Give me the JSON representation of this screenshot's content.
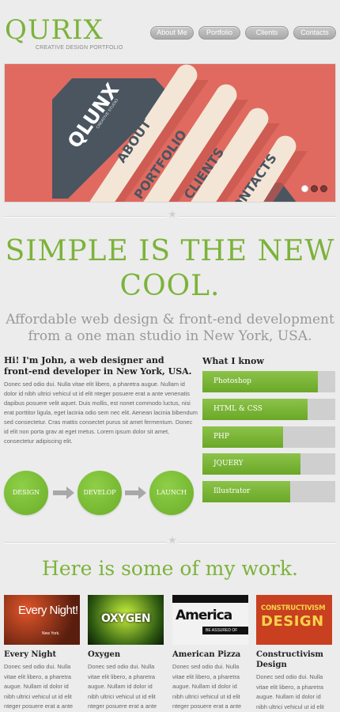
{
  "header": {
    "logo": "QURIX",
    "tagline": "CREATIVE DESIGN PORTFOLIO",
    "nav": [
      "About Me",
      "Portfolio",
      "Clients",
      "Contacts"
    ]
  },
  "slider": {
    "brand": "QLUNX",
    "brand_sub": "CREATIVE STUDIO",
    "items": [
      "ABOUT",
      "PORTFOLIO",
      "CLIENTS",
      "CONTACTS"
    ],
    "slide_count": 3,
    "active_slide": 1,
    "colors": {
      "background": "#e06a60",
      "panel": "#4a5560",
      "stripe": "#f4e6d6"
    }
  },
  "headline": "SIMPLE IS THE NEW COOL.",
  "subhead": "Affordable web design & front-end development from a one man studio in New York, USA.",
  "intro": {
    "title": "Hi! I'm John, a web designer and front-end developer in New York, USA.",
    "body": "Donec sed odio dui. Nulla vitae elit libero, a pharetra augue. Nullam id dolor id nibh ultrici vehicul ut id elit nteger posuere erat a ante venenatis dapibus posuere velit aquet. Duis mollis, est nonet commodo luctus, nisi erat porttitor ligula, eget lacinia odio sem nec elit. Aenean lacinia bibendum sed consectetur. Cras mattis consectet purus sit amet fermentum. Donec id elit non porta grav at eget metus. Lorem ipsum dolor sit amet, consectetur adipiscing elit."
  },
  "skills": {
    "title": "What I know",
    "items": [
      {
        "label": "Photoshop",
        "level": 0.87
      },
      {
        "label": "HTML & CSS",
        "level": 0.79
      },
      {
        "label": "PHP",
        "level": 0.61
      },
      {
        "label": "JQUERY",
        "level": 0.74
      },
      {
        "label": "Illustrator",
        "level": 0.66
      }
    ]
  },
  "process": [
    "DESIGN",
    "DEVELOP",
    "LAUNCH"
  ],
  "work": {
    "title": "Here is some of my work.",
    "items": [
      {
        "name": "Every Night",
        "thumb_text": "Every Night!",
        "thumb_sub": "New York.",
        "desc": "Donec sed odio dui. Nulla vitae elit libero, a pharetra augue. Nullam id dolor id nibh ultrici vehicul ut id elit nteger posuere erat a ante"
      },
      {
        "name": "Oxygen",
        "thumb_text": "OXYGEN",
        "desc": "Donec sed odio dui. Nulla vitae elit libero, a pharetra augue. Nullam id dolor id nibh ultrici vehicul ut id elit nteger posuere erat a ante"
      },
      {
        "name": "American Pizza",
        "thumb_text": "America",
        "thumb_sub": "BE ASSURED OF",
        "desc": "Donec sed odio dui. Nulla vitae elit libero, a pharetra augue. Nullam id dolor id nibh ultrici vehicul ut id elit nteger posuere erat a ante"
      },
      {
        "name": "Constructivism Design",
        "thumb_text": "CONSTRUCTIVISM",
        "thumb_sub": "DESIGN",
        "desc": "Donec sed odio dui. Nulla vitae elit libero, a pharetra augue. Nullam id dolor id nibh ultrici vehicul ut id elit nteger posuere erat a ante"
      }
    ]
  },
  "colors": {
    "accent": "#7cb33b",
    "text": "#333333",
    "muted": "#999999"
  }
}
